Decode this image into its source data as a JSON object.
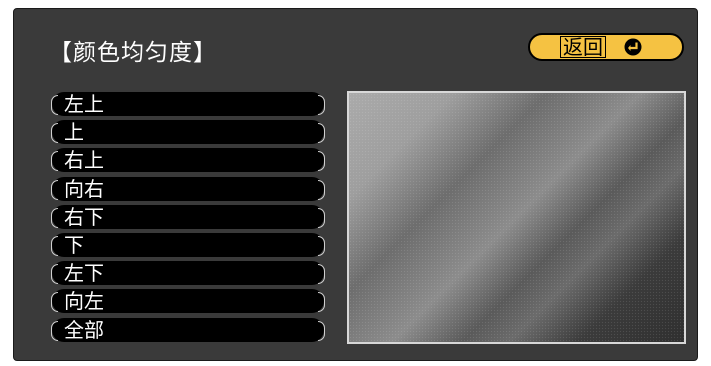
{
  "panel": {
    "title": "【颜色均匀度】",
    "back_button": {
      "label": "返回",
      "icon": "enter-icon"
    },
    "menu_items": [
      "左上",
      "上",
      "右上",
      "向右",
      "右下",
      "下",
      "左下",
      "向左",
      "全部"
    ]
  },
  "colors": {
    "panel_bg": "#3a3a3a",
    "button_accent": "#f5c242",
    "item_bg": "#000000"
  }
}
